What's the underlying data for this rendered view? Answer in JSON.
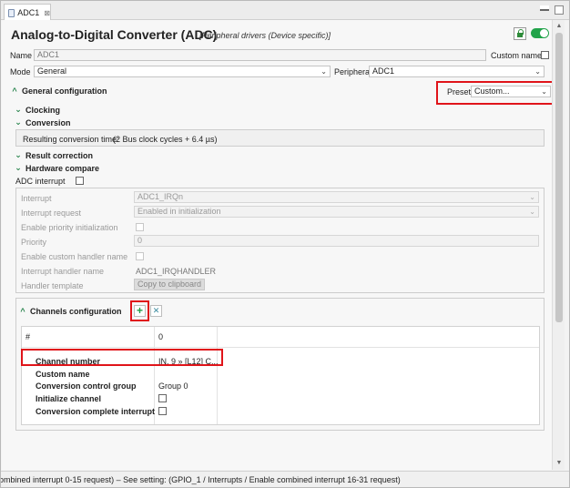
{
  "tab": {
    "label": "ADC1",
    "close": "⊠"
  },
  "header": {
    "title": "Analog-to-Digital Converter (ADC)",
    "subtitle": "[Peripheral drivers (Device specific)]"
  },
  "top": {
    "name_label": "Name",
    "name_value": "ADC1",
    "custom_name_label": "Custom name",
    "mode_label": "Mode",
    "mode_value": "General",
    "peripheral_label": "Peripheral",
    "peripheral_value": "ADC1"
  },
  "general": {
    "title": "General configuration",
    "preset_label": "Preset",
    "preset_value": "Custom..."
  },
  "sections": {
    "clocking": "Clocking",
    "conversion": "Conversion",
    "conversion_time_label": "Resulting conversion time:",
    "conversion_time_value": "(2 Bus clock cycles + 6.4 µs)",
    "result_correction": "Result correction",
    "hardware_compare": "Hardware compare",
    "adc_interrupt": "ADC interrupt"
  },
  "interrupt": {
    "interrupt_label": "Interrupt",
    "interrupt_value": "ADC1_IRQn",
    "request_label": "Interrupt request",
    "request_value": "Enabled in initialization",
    "priority_init_label": "Enable priority initialization",
    "priority_label": "Priority",
    "priority_value": "0",
    "custom_handler_label": "Enable custom handler name",
    "handler_name_label": "Interrupt handler name",
    "handler_name_value": "ADC1_IRQHANDLER",
    "template_label": "Handler template",
    "copy_button": "Copy to clipboard"
  },
  "channels": {
    "title": "Channels configuration",
    "add": "+",
    "remove": "✕",
    "header_hash": "#",
    "header_index": "0",
    "rows": [
      {
        "label": "Channel number",
        "value": "IN, 9 » [L12] C..."
      },
      {
        "label": "Custom name",
        "value": ""
      },
      {
        "label": "Conversion control group",
        "value": "Group 0"
      },
      {
        "label": "Initialize channel",
        "value": ""
      },
      {
        "label": "Conversion complete interrupt",
        "value": ""
      }
    ]
  },
  "status": {
    "text": "ombined interrupt 0-15 request) – See setting: (GPIO_1 / Interrupts / Enable combined interrupt 16-31 request)"
  },
  "icons": {
    "chevron_expanded": "⌄",
    "chevron_collapsed": "^",
    "dropdown": "⌄"
  },
  "colors": {
    "accent": "#22a34a",
    "highlight": "#e0141a"
  }
}
